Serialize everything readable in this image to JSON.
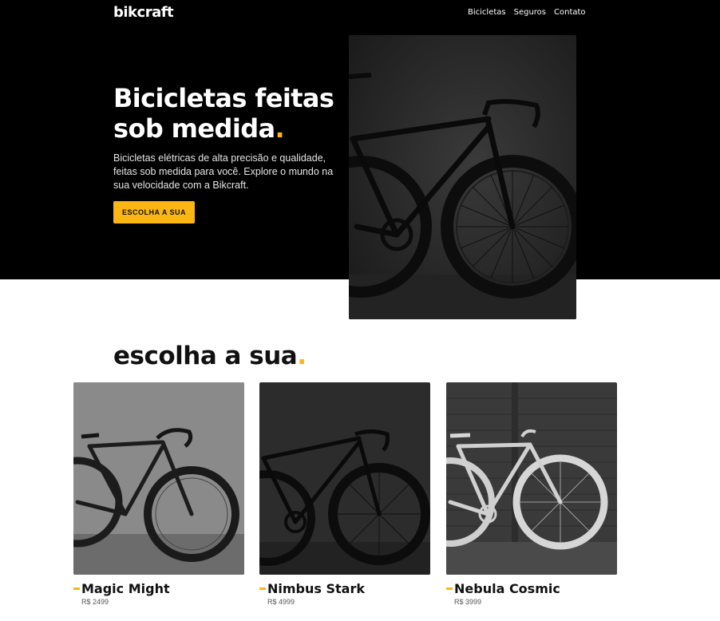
{
  "header": {
    "logo": "bikcraft",
    "nav": [
      "Bicicletas",
      "Seguros",
      "Contato"
    ]
  },
  "hero": {
    "title": "Bicicletas feitas sob medida",
    "title_dot": ".",
    "description": "Bicicletas elétricas de alta precisão e qualidade, feitas sob medida para você. Explore o mundo na sua velocidade com a Bikcraft.",
    "cta_label": "ESCOLHA A SUA"
  },
  "products": {
    "title": "escolha a sua",
    "title_dot": ".",
    "items": [
      {
        "name": "Magic Might",
        "price": "R$ 2499"
      },
      {
        "name": "Nimbus Stark",
        "price": "R$ 4999"
      },
      {
        "name": "Nebula Cosmic",
        "price": "R$ 3999"
      }
    ]
  },
  "colors": {
    "accent": "#FBB613",
    "hero_bg": "#000000"
  },
  "icons": [
    "bike-photo"
  ]
}
